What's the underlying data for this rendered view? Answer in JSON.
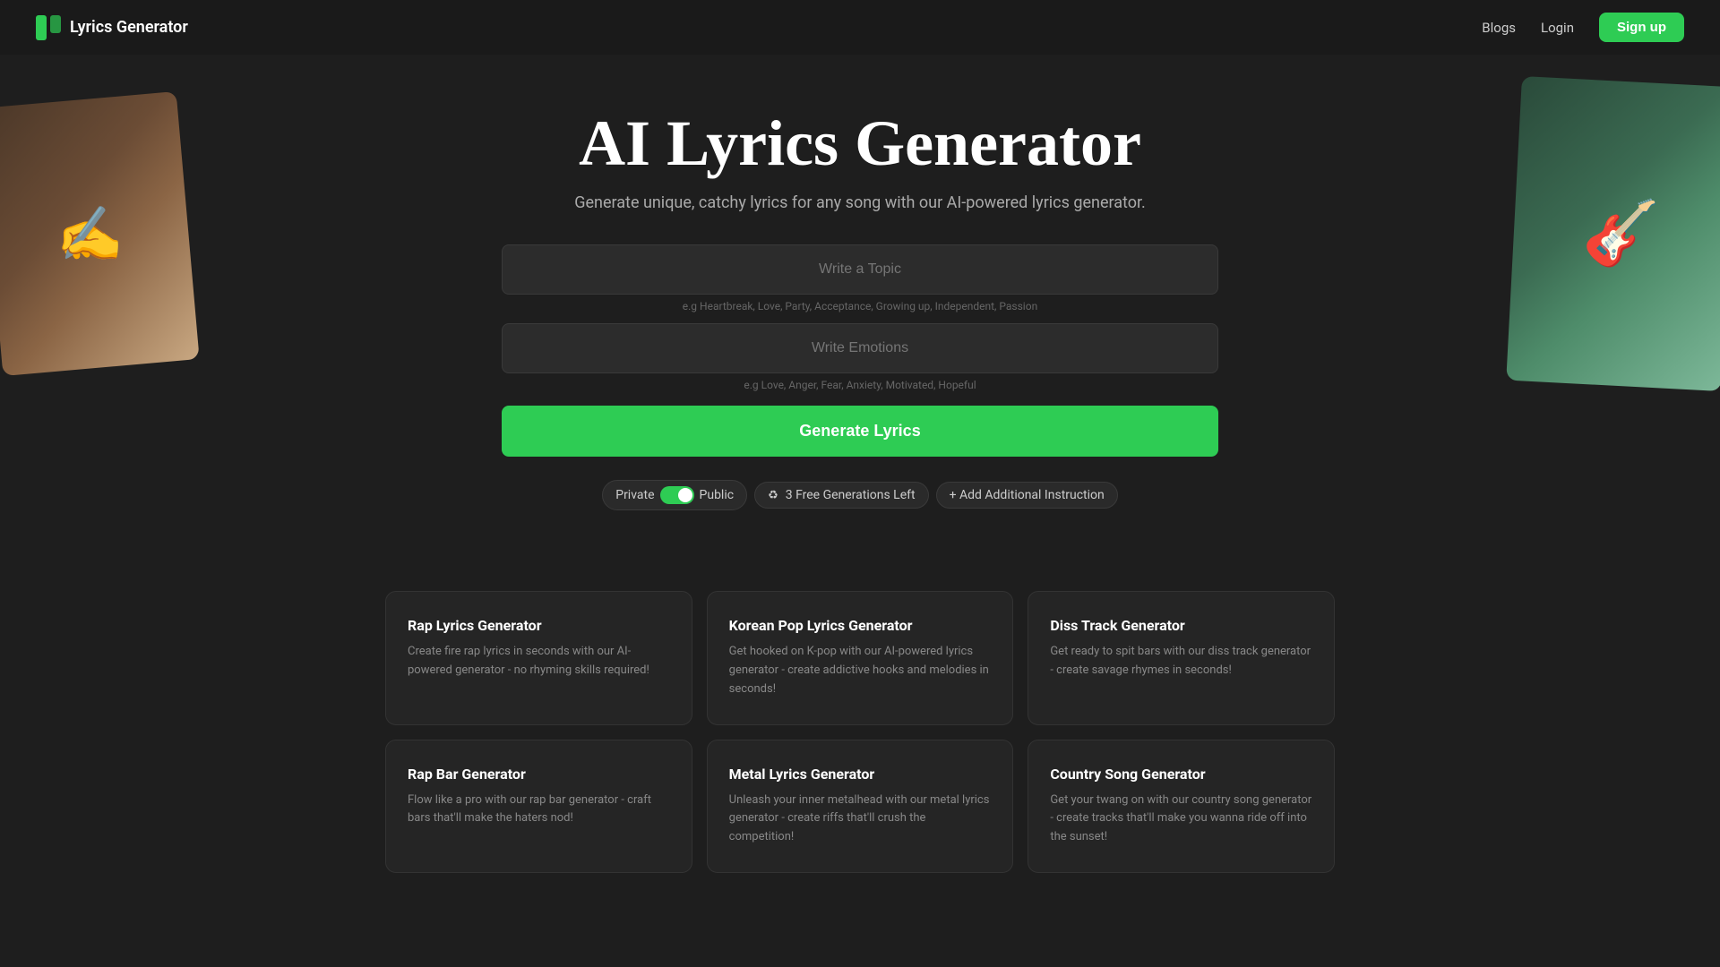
{
  "nav": {
    "logo_text": "Lyrics Generator",
    "blogs_label": "Blogs",
    "login_label": "Login",
    "signup_label": "Sign up"
  },
  "hero": {
    "title": "AI Lyrics Generator",
    "subtitle": "Generate unique, catchy lyrics for any song with our AI-powered lyrics generator."
  },
  "form": {
    "topic_placeholder": "Write a Topic",
    "topic_hint": "e.g Heartbreak, Love, Party, Acceptance, Growing up, Independent, Passion",
    "emotions_placeholder": "Write Emotions",
    "emotions_hint": "e.g Love, Anger, Fear, Anxiety, Motivated, Hopeful",
    "generate_label": "Generate Lyrics"
  },
  "options": {
    "private_label": "Private",
    "public_label": "Public",
    "free_generations_label": "3 Free Generations Left",
    "add_instruction_label": "+ Add Additional Instruction"
  },
  "cards": [
    {
      "title": "Rap Lyrics Generator",
      "desc": "Create fire rap lyrics in seconds with our AI-powered generator - no rhyming skills required!"
    },
    {
      "title": "Korean Pop Lyrics Generator",
      "desc": "Get hooked on K-pop with our AI-powered lyrics generator - create addictive hooks and melodies in seconds!"
    },
    {
      "title": "Diss Track Generator",
      "desc": "Get ready to spit bars with our diss track generator - create savage rhymes in seconds!"
    },
    {
      "title": "Rap Bar Generator",
      "desc": "Flow like a pro with our rap bar generator - craft bars that'll make the haters nod!"
    },
    {
      "title": "Metal Lyrics Generator",
      "desc": "Unleash your inner metalhead with our metal lyrics generator - create riffs that'll crush the competition!"
    },
    {
      "title": "Country Song Generator",
      "desc": "Get your twang on with our country song generator - create tracks that'll make you wanna ride off into the sunset!"
    }
  ]
}
